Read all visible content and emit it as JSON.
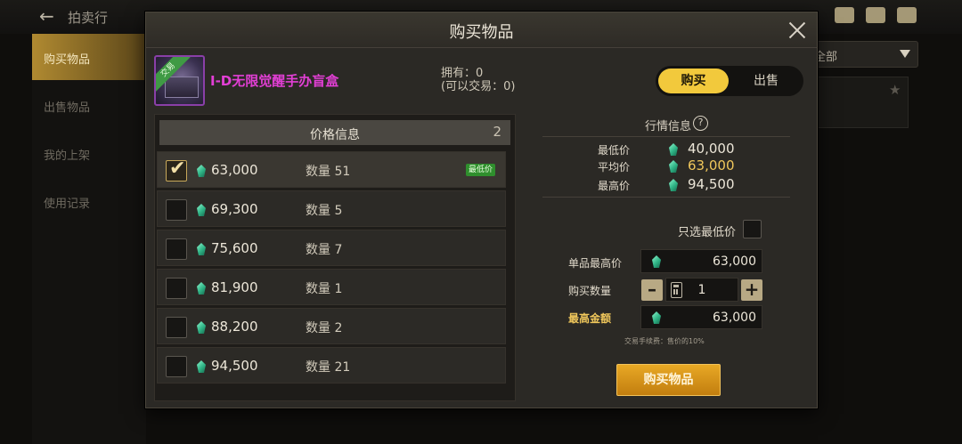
{
  "background": {
    "title": "拍卖行",
    "sidebar": [
      "购买物品",
      "出售物品",
      "我的上架",
      "使用记录"
    ],
    "dropdown": "全部"
  },
  "modal": {
    "title": "购买物品",
    "item": {
      "badge": "交易",
      "name": "I-D无限觉醒手办盲盒",
      "owned": "拥有：0",
      "tradable": "(可以交易：0)"
    },
    "tabs": {
      "buy": "购买",
      "sell": "出售"
    },
    "price_list": {
      "header": "价格信息",
      "count": "2",
      "lowest_badge": "最低价",
      "rows": [
        {
          "price": "63,000",
          "qty": "数量 51",
          "checked": true
        },
        {
          "price": "69,300",
          "qty": "数量 5",
          "checked": false
        },
        {
          "price": "75,600",
          "qty": "数量 7",
          "checked": false
        },
        {
          "price": "81,900",
          "qty": "数量 1",
          "checked": false
        },
        {
          "price": "88,200",
          "qty": "数量 2",
          "checked": false
        },
        {
          "price": "94,500",
          "qty": "数量 21",
          "checked": false
        }
      ]
    },
    "market": {
      "title": "行情信息",
      "help": "?",
      "lowest_label": "最低价",
      "lowest_value": "40,000",
      "average_label": "平均价",
      "average_value": "63,000",
      "highest_label": "最高价",
      "highest_value": "94,500"
    },
    "form": {
      "only_lowest": "只选最低价",
      "unit_max_label": "单品最高价",
      "unit_max_value": "63,000",
      "quantity_label": "购买数量",
      "quantity_value": "1",
      "total_label": "最高金额",
      "total_value": "63,000",
      "fee_note": "交易手续费：售价的10%",
      "buy_button": "购买物品"
    }
  },
  "colors": {
    "accent": "#f2c93c",
    "item_name": "#e33fd6",
    "average_value": "#f0c75b",
    "buy_button": "#e8a825"
  }
}
